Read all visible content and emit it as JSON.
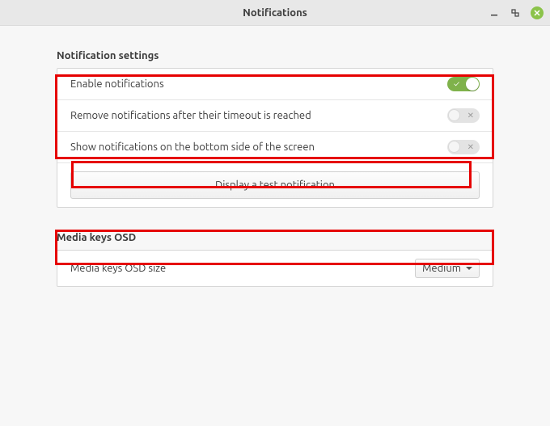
{
  "window": {
    "title": "Notifications"
  },
  "section_notifications": {
    "header": "Notification settings",
    "rows": {
      "enable": {
        "label": "Enable notifications",
        "on": true
      },
      "timeout": {
        "label": "Remove notifications after their timeout is reached",
        "on": false
      },
      "bottom": {
        "label": "Show notifications on the bottom side of the screen",
        "on": false
      }
    },
    "test_button": "Display a test notification"
  },
  "section_osd": {
    "header": "Media keys OSD",
    "row": {
      "label": "Media keys OSD size"
    },
    "dropdown_value": "Medium"
  },
  "colors": {
    "toggle_on": "#7fb24b",
    "close_btn": "#8bc34a",
    "callout": "#e60000"
  }
}
